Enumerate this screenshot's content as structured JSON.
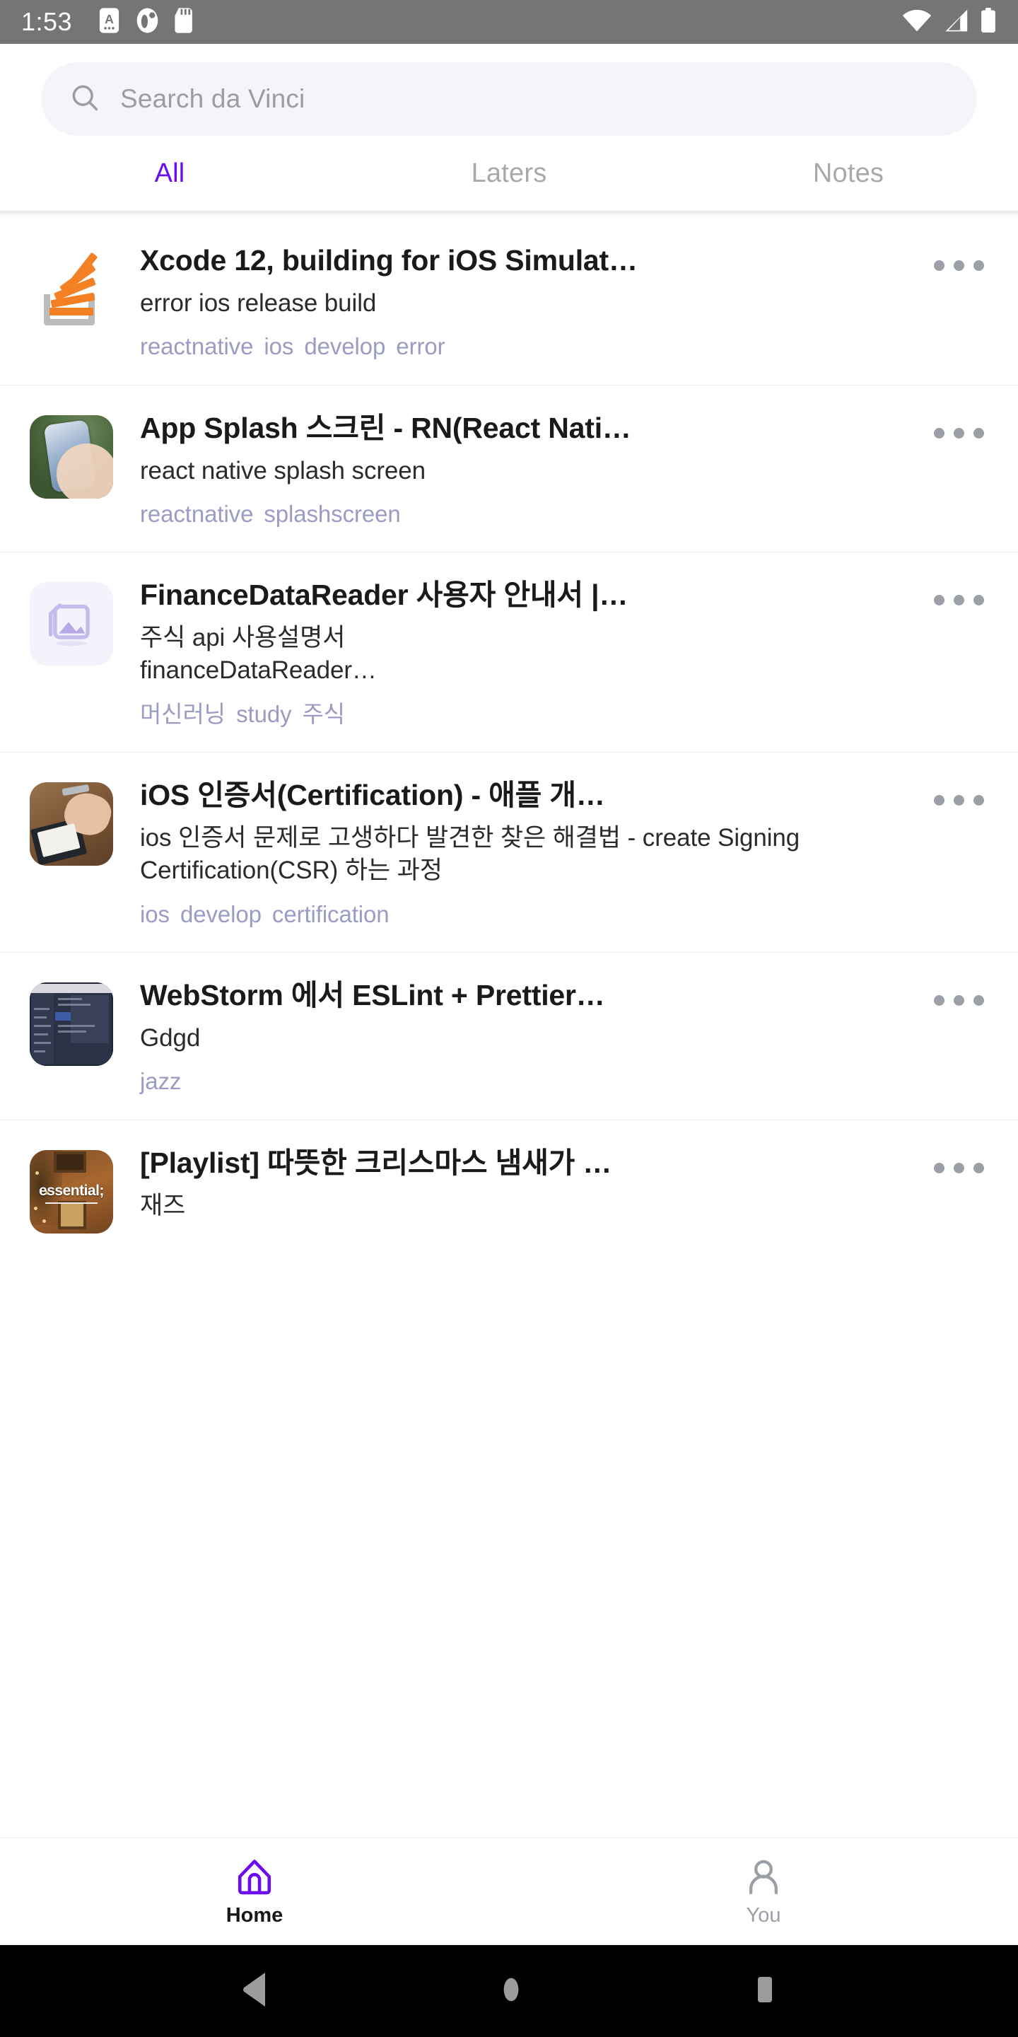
{
  "status_bar": {
    "time": "1:53",
    "left_icons": [
      "android-auto-icon",
      "do-not-disturb-icon",
      "sd-card-icon"
    ],
    "right_icons": [
      "wifi-icon",
      "cellular-signal-icon",
      "battery-icon"
    ],
    "background": "#757575"
  },
  "search": {
    "placeholder": "Search da Vinci",
    "value": "",
    "icon": "search-icon"
  },
  "tabs": {
    "active_index": 0,
    "accent_color": "#6a0def",
    "inactive_color": "#a8a8ad",
    "items": [
      {
        "label": "All"
      },
      {
        "label": "Laters"
      },
      {
        "label": "Notes"
      }
    ]
  },
  "list": {
    "more_icon": "more-horizontal-icon",
    "items": [
      {
        "title": "Xcode 12, building for iOS Simulat…",
        "description": "error ios release build",
        "tags": "reactnative  ios  develop  error",
        "thumbnail": "stackoverflow-logo-thumbnail"
      },
      {
        "title": "App Splash 스크린 - RN(React Nati…",
        "description": "react native splash screen",
        "tags": "reactnative  splashscreen",
        "thumbnail": "phone-in-hand-photo-thumbnail"
      },
      {
        "title": "FinanceDataReader 사용자 안내서 |…",
        "description": "주식 api 사용설명서\nfinanceDataReader…",
        "tags": "머신러닝  study  주식",
        "thumbnail": "image-placeholder-thumbnail"
      },
      {
        "title": "iOS 인증서(Certification) - 애플 개…",
        "description": "ios 인증서 문제로 고생하다 발견한 찾은 해결법 - create Signing Certification(CSR) 하는 과정",
        "tags": "ios  develop  certification",
        "thumbnail": "desk-writing-photo-thumbnail"
      },
      {
        "title": "WebStorm 에서 ESLint + Prettier…",
        "description": "Gdgd",
        "tags": "jazz",
        "thumbnail": "ide-screenshot-thumbnail"
      },
      {
        "title": "[Playlist] 따뜻한 크리스마스 냄새가 …",
        "description": "재즈",
        "tags": "",
        "thumbnail": "christmas-playlist-thumbnail",
        "thumbnail_caption": "essential;"
      }
    ]
  },
  "bottom_nav": {
    "active_index": 0,
    "active_color": "#6a0def",
    "inactive_color": "#9aa0a6",
    "items": [
      {
        "label": "Home",
        "icon": "home-icon"
      },
      {
        "label": "You",
        "icon": "person-icon"
      }
    ]
  },
  "android_nav": {
    "background": "#000000",
    "items": [
      {
        "label": "Back",
        "icon": "back-triangle-icon"
      },
      {
        "label": "Home",
        "icon": "home-circle-icon"
      },
      {
        "label": "Recents",
        "icon": "recents-square-icon"
      }
    ]
  }
}
